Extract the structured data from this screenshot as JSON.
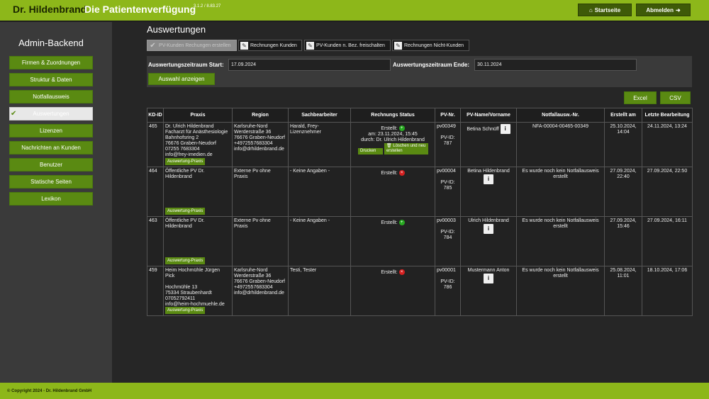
{
  "header": {
    "brand": "Dr. Hildenbrand",
    "subtitle": "Die Patientenverfügung",
    "version": "3.1.2 / 8.83.27",
    "home_label": "Startseite",
    "logout_label": "Abmelden"
  },
  "sidebar": {
    "title": "Admin-Backend",
    "items": [
      {
        "label": "Firmen & Zuordnungen"
      },
      {
        "label": "Struktur & Daten"
      },
      {
        "label": "Notfallausweis"
      },
      {
        "label": "Auswertungen",
        "active": true
      },
      {
        "label": "Lizenzen"
      },
      {
        "label": "Nachrichten an Kunden"
      },
      {
        "label": "Benutzer"
      },
      {
        "label": "Statische Seiten"
      },
      {
        "label": "Lexikon"
      }
    ]
  },
  "main": {
    "title": "Auswertungen",
    "tabs": [
      {
        "label": "PV-Kunden Rechungen erstellen"
      },
      {
        "label": "Rechnungen Kunden"
      },
      {
        "label": "PV-Kunden n. Bez. freischalten"
      },
      {
        "label": "Rechnungen Nicht-Kunden"
      }
    ],
    "filter": {
      "start_label": "Auswertungszeitraum Start:",
      "start_value": "17.09.2024",
      "end_label": "Auswertungszeitraum Ende:",
      "end_value": "30.11.2024",
      "submit_label": "Auswahl anzeigen"
    },
    "export": {
      "excel": "Excel",
      "csv": "CSV"
    },
    "table": {
      "headers": {
        "kdid": "KD-ID",
        "praxis": "Praxis",
        "region": "Region",
        "sachbearbeiter": "Sachbearbeiter",
        "status": "Rechnungs Status",
        "pvnr": "PV-Nr.",
        "pvname": "PV-Name/Vorname",
        "notfall": "Notfallausw.-Nr.",
        "erstellt": "Erstellt am",
        "letzte": "Letzte Bearbeitung"
      },
      "praxis_button": "Auswertung-Praxis",
      "rows": [
        {
          "kdid": "465",
          "praxis": [
            "Dr. Ulrich Hildenbrand",
            "Facharzt für Anästhesiologie",
            "Bahnhofsring 2",
            "76676 Graben-Neudorf",
            "07255 7683304",
            "info@frey-imedien.de"
          ],
          "region": [
            "Karlsruhe-Nord",
            "Werderstraße 36",
            "76676 Graben-Neudorf",
            "+4972557683304",
            "info@drhildenbrand.de"
          ],
          "sachbearbeiter": "Harald, Frey-Lizenznehmer",
          "status_label": "Erstellt:",
          "status_ok": true,
          "status_am": "am: 23.11.2024, 15:45",
          "status_durch": "durch: Dr. Ulrich Hildenbrand",
          "print_label": "Drucken",
          "delete_label": "Löschen und neu erstellen",
          "pvnr": "pv00349",
          "pvid_label": "PV-ID:",
          "pvid": "787",
          "pvname": "Betina Schnüff",
          "notfall": "NFA-00004-00465-00349",
          "erstellt": "25.10.2024, 14:04",
          "letzte": "24.11.2024, 13:24"
        },
        {
          "kdid": "464",
          "praxis": [
            "Öffentliche PV Dr.",
            "Hildenbrand"
          ],
          "region": [
            "Externe Pv ohne",
            "Praxis"
          ],
          "sachbearbeiter": "- Keine Angaben -",
          "status_label": "Erstellt:",
          "status_ok": false,
          "pvnr": "pv00004",
          "pvid_label": "PV-ID:",
          "pvid": "785",
          "pvname": "Betina Hildenbrand",
          "notfall": "Es wurde noch kein Notfallausweis erstellt",
          "erstellt": "27.09.2024, 22:40",
          "letzte": "27.09.2024, 22:50"
        },
        {
          "kdid": "463",
          "praxis": [
            "Öffentliche PV Dr.",
            "Hildenbrand"
          ],
          "region": [
            "Externe Pv ohne",
            "Praxis"
          ],
          "sachbearbeiter": "- Keine Angaben -",
          "status_label": "Erstellt:",
          "status_ok": true,
          "pvnr": "pv00003",
          "pvid_label": "PV-ID:",
          "pvid": "784",
          "pvname": "Ulrich Hildenbrand",
          "notfall": "Es wurde noch kein Notfallausweis erstellt",
          "erstellt": "27.09.2024, 15:46",
          "letzte": "27.09.2024, 16:11"
        },
        {
          "kdid": "459",
          "praxis": [
            "Heim Hochmühle Jürgen Pick",
            "",
            "Hochmühle 13",
            "75334 Straubenhardt",
            "07052792411",
            "info@heim-hochmuehle.de"
          ],
          "region": [
            "Karlsruhe-Nord",
            "Werderstraße 36",
            "76676 Graben-Neudorf",
            "+4972557683304",
            "info@drhildenbrand.de"
          ],
          "sachbearbeiter": "Testi, Tester",
          "status_label": "Erstellt:",
          "status_ok": false,
          "pvnr": "pv00001",
          "pvid_label": "PV-ID:",
          "pvid": "786",
          "pvname": "Mustermann Anton",
          "notfall": "Es wurde noch kein Notfallausweis erstellt",
          "erstellt": "25.08.2024, 11:01",
          "letzte": "18.10.2024, 17:06"
        }
      ]
    }
  },
  "footer": {
    "copyright": "© Copyright 2024 - Dr. Hildenbrand GmbH"
  }
}
